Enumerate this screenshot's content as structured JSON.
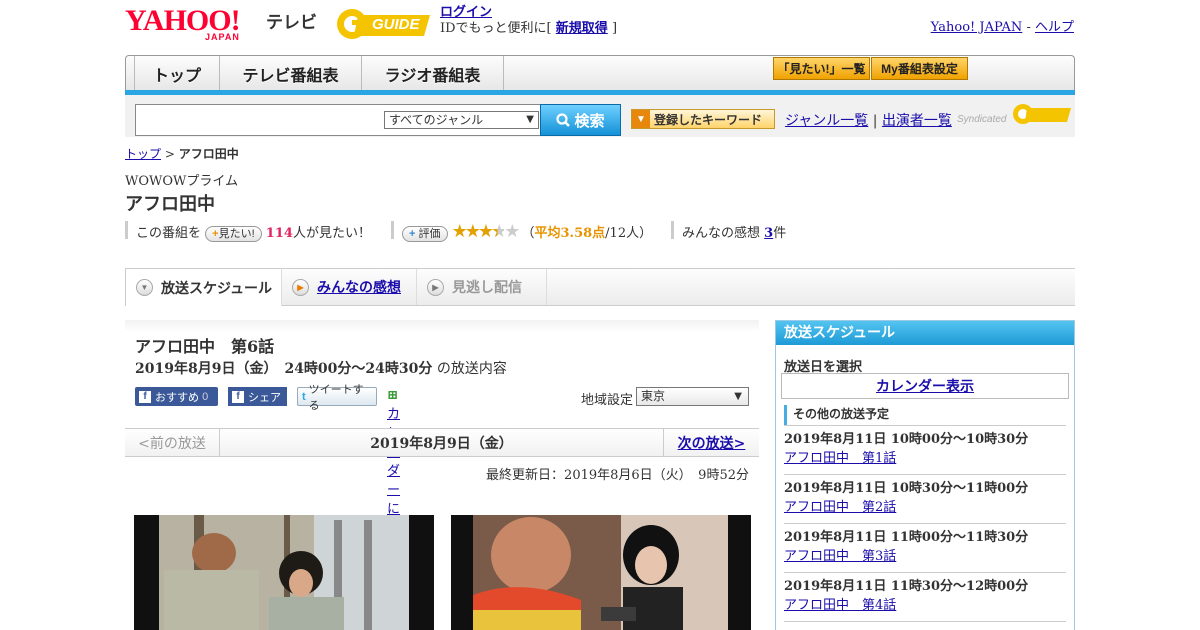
{
  "header": {
    "logo": "YAHOO!",
    "logo_sub": "JAPAN",
    "service": "テレビ",
    "partner": "GUIDE",
    "login": "ログイン",
    "login_note": "IDでもっと便利に[",
    "signup": "新規取得",
    "signup_close": "]",
    "yahoo_japan": "Yahoo! JAPAN",
    "sep": "-",
    "help": "ヘルプ"
  },
  "nav": {
    "tabs": [
      {
        "label": "トップ"
      },
      {
        "label": "テレビ番組表"
      },
      {
        "label": "ラジオ番組表"
      }
    ],
    "want_list": "「見たい!」一覧",
    "my_schedule": "My番組表設定"
  },
  "search": {
    "placeholder": "",
    "genre": "すべてのジャンル",
    "button": "検索",
    "keyword_button": "登録したキーワード",
    "genre_list": "ジャンル一覧",
    "divider": "|",
    "performer_list": "出演者一覧",
    "syndicated": "Syndicated"
  },
  "breadcrumb": {
    "top": "トップ",
    "sep": ">",
    "current": "アフロ田中"
  },
  "program": {
    "channel": "WOWOWプライム",
    "title": "アフロ田中",
    "want_prefix": "この番組を",
    "want_button": "見たい!",
    "want_count": "114",
    "want_suffix": "人が見たい！",
    "rate_button": "評価",
    "rating_avg": "平均3.58点",
    "rating_text_open": "（",
    "rating_text_count": "/12人）",
    "rating": 3.58,
    "reviews_label": "みんなの感想",
    "reviews_count": "3",
    "reviews_suffix": "件"
  },
  "tabs": {
    "schedule": "放送スケジュール",
    "reviews": "みんなの感想",
    "stream": "見逃し配信"
  },
  "episode": {
    "title": "アフロ田中　第6話",
    "datetime": "2019年8月9日（金）　24時00分～24時30分",
    "datetime_suffix": "の放送内容",
    "fb_recommend": "おすすめ",
    "fb_count": "0",
    "fb_share": "シェア",
    "tweet": "ツイートする",
    "calendar": "カレンダーに登録",
    "region_label": "地域設定",
    "region": "東京",
    "prev": "<前の放送",
    "current_date": "2019年8月9日（金）",
    "next": "次の放送>",
    "updated": "最終更新日：2019年8月6日（火）　9時52分"
  },
  "sidebar": {
    "title": "放送スケジュール",
    "date_label": "放送日を選択",
    "calendar_button": "カレンダー表示",
    "other_heading": "その他の放送予定",
    "items": [
      {
        "time": "2019年8月11日  10時00分～10時30分",
        "title": "アフロ田中　第1話"
      },
      {
        "time": "2019年8月11日  10時30分～11時00分",
        "title": "アフロ田中　第2話"
      },
      {
        "time": "2019年8月11日  11時00分～11時30分",
        "title": "アフロ田中　第3話"
      },
      {
        "time": "2019年8月11日  11時30分～12時00分",
        "title": "アフロ田中　第4話"
      }
    ]
  },
  "colors": {
    "accent_blue": "#2aa6e3",
    "link": "#1a0dab",
    "star": "#e3a100",
    "want_count": "#e0245e"
  }
}
